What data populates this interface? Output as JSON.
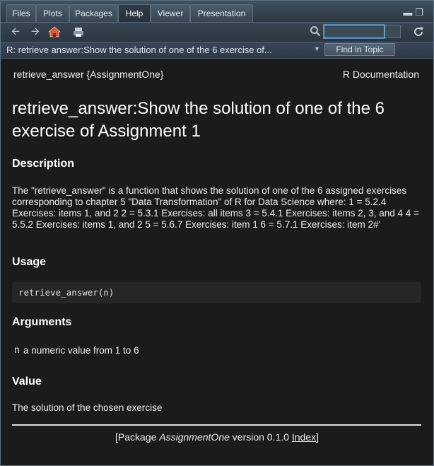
{
  "tabs": [
    {
      "label": "Files",
      "active": false
    },
    {
      "label": "Plots",
      "active": false
    },
    {
      "label": "Packages",
      "active": false
    },
    {
      "label": "Help",
      "active": true
    },
    {
      "label": "Viewer",
      "active": false
    },
    {
      "label": "Presentation",
      "active": false
    }
  ],
  "toolbar": {
    "icons": [
      "back-arrow-icon",
      "forward-arrow-icon",
      "home-icon",
      "print-icon",
      "search-icon",
      "refresh-icon"
    ],
    "search_value": ""
  },
  "topic": {
    "title": "R: retrieve  answer:Show the solution of one of the 6 exercise of...",
    "find_label": "Find in Topic"
  },
  "doc": {
    "header_left": "retrieve_answer {AssignmentOne}",
    "header_right": "R Documentation",
    "title": "retrieve_answer:Show the solution of one of the 6 exercise of Assignment 1",
    "description_heading": "Description",
    "description": "The \"retrieve_answer\" is a function that shows the solution of one of the 6 assigned exercises corresponding to chapter 5 \"Data Transformation\" of R for Data Science where: 1 = 5.2.4 Exercises: items 1, and 2 2 = 5.3.1 Exercises: all items 3 = 5.4.1 Exercises: items 2, 3, and 4 4 = 5.5.2 Exercises: items 1, and 2 5 = 5.6.7 Exercises: item 1 6 = 5.7.1 Exercises: item 2#'",
    "usage_heading": "Usage",
    "usage_code": "retrieve_answer(n)",
    "arguments_heading": "Arguments",
    "arg_name": "n",
    "arg_desc": "a numeric value from 1 to 6",
    "value_heading": "Value",
    "value_text": "The solution of the chosen exercise",
    "footer_prefix": "[Package ",
    "footer_pkg": "AssignmentOne",
    "footer_version": " version 0.1.0 ",
    "footer_index": "Index",
    "footer_suffix": "]"
  },
  "colors": {
    "background": "#1b1b1b",
    "chrome": "#2c3944",
    "accent": "#7fb2dc",
    "home_icon": "#d9573a"
  }
}
